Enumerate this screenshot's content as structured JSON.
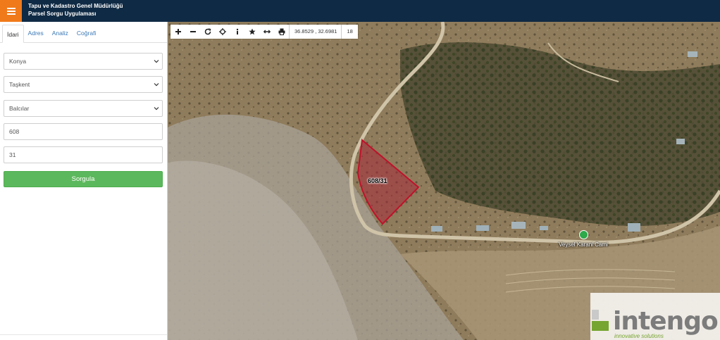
{
  "header": {
    "title_line1": "Tapu ve Kadastro Genel Müdürlüğü",
    "title_line2": "Parsel Sorgu Uygulaması",
    "menu_icon": "hamburger-icon",
    "colors": {
      "bar": "#0f2a44",
      "menu": "#f07a1a"
    }
  },
  "sidebar": {
    "tabs": [
      {
        "label": "İdari",
        "active": true
      },
      {
        "label": "Adres",
        "active": false
      },
      {
        "label": "Analiz",
        "active": false
      },
      {
        "label": "Coğrafi",
        "active": false
      }
    ],
    "fields": {
      "province": "Konya",
      "district": "Taşkent",
      "neighborhood": "Balcılar",
      "block": "608",
      "parcel": "31"
    },
    "query_button": "Sorgula",
    "colors": {
      "button": "#5cb85c"
    }
  },
  "map": {
    "toolbar": {
      "icons": [
        "zoom-in-icon",
        "zoom-out-icon",
        "refresh-icon",
        "locate-icon",
        "info-icon",
        "bookmark-icon",
        "measure-icon",
        "print-icon"
      ],
      "coordinates": "36.8529 , 32.6981",
      "zoom_level": "18"
    },
    "parcel_label": "608/31",
    "poi_label": "Veysel Karani Cami",
    "watermark": {
      "brand": "intengo",
      "tagline": "innovative solutions"
    },
    "colors": {
      "parcel_outline": "#c0122a",
      "parcel_fill": "#a8283a"
    }
  }
}
